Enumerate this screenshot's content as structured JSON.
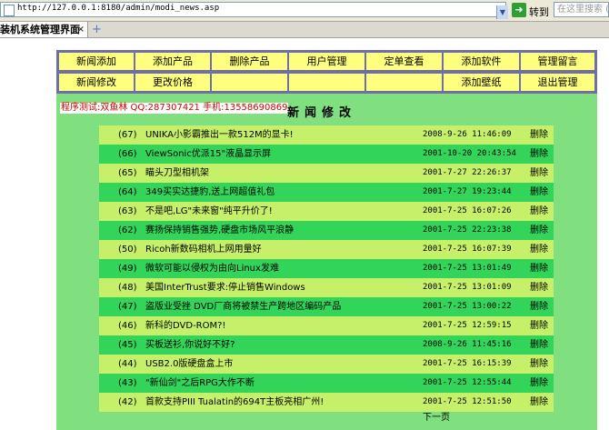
{
  "browser": {
    "url": "http://127.0.0.1:8180/admin/modi_news.asp",
    "go_label": "转到",
    "search_placeholder": "在这里搜索 (A",
    "tab_title": "装机系统管理界面",
    "tab_close": "×",
    "new_tab": "+"
  },
  "nav": {
    "row1": [
      "新闻添加",
      "添加产品",
      "删除产品",
      "用户管理",
      "定单查看",
      "添加软件",
      "管理留言"
    ],
    "row2": [
      "新闻修改",
      "更改价格",
      "",
      "",
      "",
      "添加壁纸",
      "退出管理"
    ]
  },
  "credit": "程序测试:双鱼林 QQ:287307421 手机:13558690869",
  "page_title": "新闻修改",
  "delete_label": "删除",
  "news": [
    {
      "id": "(67)",
      "title": "UNIKA小影霸推出一款512M的显卡!",
      "date": "2008-9-26 11:46:09"
    },
    {
      "id": "(66)",
      "title": "ViewSonic优派15\"液晶显示屏",
      "date": "2001-10-20 20:43:54"
    },
    {
      "id": "(65)",
      "title": "瞄头刀型相机架",
      "date": "2001-7-27 22:26:37"
    },
    {
      "id": "(64)",
      "title": "349买实达捷豹,送上网超值礼包",
      "date": "2001-7-27 19:23:44"
    },
    {
      "id": "(63)",
      "title": "不是吧,LG\"未来窗\"纯平升价了!",
      "date": "2001-7-25 16:07:26"
    },
    {
      "id": "(62)",
      "title": "赛扬保持销售强势,硬盘市场风平浪静",
      "date": "2001-7-25 22:23:38"
    },
    {
      "id": "(50)",
      "title": "Ricoh新数码相机上网用量好",
      "date": "2001-7-25 16:07:39"
    },
    {
      "id": "(49)",
      "title": "微软可能以侵权为由向Linux发难",
      "date": "2001-7-25 13:01:49"
    },
    {
      "id": "(48)",
      "title": "美国InterTrust要求:停止销售Windows",
      "date": "2001-7-25 13:01:09"
    },
    {
      "id": "(47)",
      "title": "盗版业受挫 DVD厂商将被禁生产跨地区编码产品",
      "date": "2001-7-25 13:00:22"
    },
    {
      "id": "(46)",
      "title": "新科的DVD-ROM?!",
      "date": "2001-7-25 12:59:15"
    },
    {
      "id": "(45)",
      "title": "买板送衫,你说好不好?",
      "date": "2008-9-26 11:45:16"
    },
    {
      "id": "(44)",
      "title": "USB2.0版硬盘盒上市",
      "date": "2001-7-25 16:15:39"
    },
    {
      "id": "(43)",
      "title": "\"新仙剑\"之后RPG大作不断",
      "date": "2001-7-25 12:55:44"
    },
    {
      "id": "(42)",
      "title": "首款支持PIII Tualatin的694T主板亮相广州!",
      "date": "2001-7-25 12:51:50"
    }
  ],
  "next_page": "下一页",
  "colors": {
    "frame": "#80e080",
    "nav_button": "#ffff7f",
    "nav_border": "#6f6fa8",
    "row_light": "#c6f06a",
    "row_dark": "#33d45a",
    "credit_text": "#d00000"
  }
}
